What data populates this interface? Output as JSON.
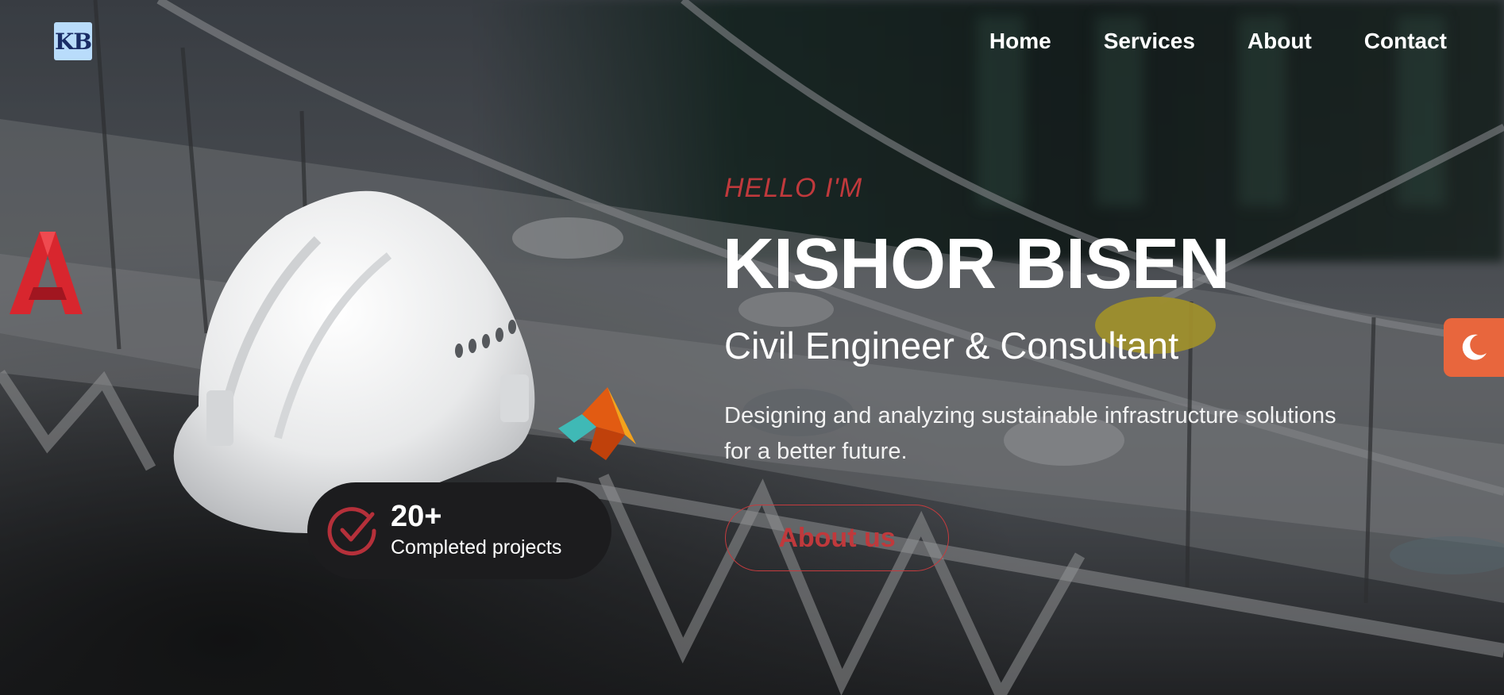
{
  "nav": {
    "logo_text": "KB",
    "items": [
      {
        "label": "Home"
      },
      {
        "label": "Services"
      },
      {
        "label": "About"
      },
      {
        "label": "Contact"
      }
    ]
  },
  "hero": {
    "greeting": "HELLO I'M",
    "name": "KISHOR BISEN",
    "role": "Civil Engineer & Consultant",
    "description": "Designing and analyzing sustainable infrastructure solutions for a better future.",
    "button_label": "About us"
  },
  "stats": {
    "count": "20+",
    "label": "Completed projects"
  },
  "icons": {
    "theme_toggle": "moon-icon",
    "stats_icon": "check-circle-icon",
    "autocad": "autocad-logo-icon",
    "matlab": "matlab-logo-icon",
    "helmet": "hard-hat-image"
  },
  "colors": {
    "accent": "#c0393c",
    "toggle": "#e8663d",
    "badge_bg": "#1c1c1e",
    "logo_bg": "#b9dcfb"
  }
}
